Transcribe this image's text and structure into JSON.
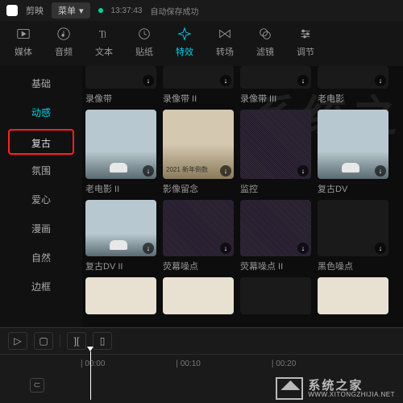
{
  "titlebar": {
    "app_name": "剪映",
    "menu_label": "菜单",
    "save_time": "13:37:43",
    "save_status": "自动保存成功"
  },
  "toolbar": [
    {
      "id": "media",
      "label": "媒体",
      "icon": "play-rect"
    },
    {
      "id": "audio",
      "label": "音频",
      "icon": "music-note"
    },
    {
      "id": "text",
      "label": "文本",
      "icon": "text-t"
    },
    {
      "id": "sticker",
      "label": "贴纸",
      "icon": "clock"
    },
    {
      "id": "effect",
      "label": "特效",
      "icon": "sparkle",
      "active": true
    },
    {
      "id": "transition",
      "label": "转场",
      "icon": "bowtie"
    },
    {
      "id": "filter",
      "label": "滤镜",
      "icon": "venn"
    },
    {
      "id": "adjust",
      "label": "调节",
      "icon": "sliders"
    }
  ],
  "sidebar": [
    {
      "id": "basic",
      "label": "基础"
    },
    {
      "id": "dynamic",
      "label": "动感",
      "active": true
    },
    {
      "id": "retro",
      "label": "复古",
      "highlight": true
    },
    {
      "id": "ambience",
      "label": "氛围"
    },
    {
      "id": "heart",
      "label": "爱心"
    },
    {
      "id": "comic",
      "label": "漫画"
    },
    {
      "id": "nature",
      "label": "自然"
    },
    {
      "id": "border",
      "label": "边框"
    }
  ],
  "grid": {
    "row1": [
      "录像带",
      "录像带 II",
      "录像带 III",
      "老电影"
    ],
    "row2": [
      "老电影 II",
      "影像留念",
      "监控",
      "复古DV"
    ],
    "row2_overlay": [
      "",
      "2021 新年倒数",
      "",
      ""
    ],
    "row3": [
      "复古DV II",
      "荧幕噪点",
      "荧幕噪点 II",
      "黑色噪点"
    ]
  },
  "timeline": {
    "ticks": [
      "00:00",
      "00:10",
      "00:20"
    ]
  },
  "watermark": {
    "cn": "系统之家",
    "en": "WWW.XITONGZHIJIA.NET",
    "bg": "系统之"
  }
}
